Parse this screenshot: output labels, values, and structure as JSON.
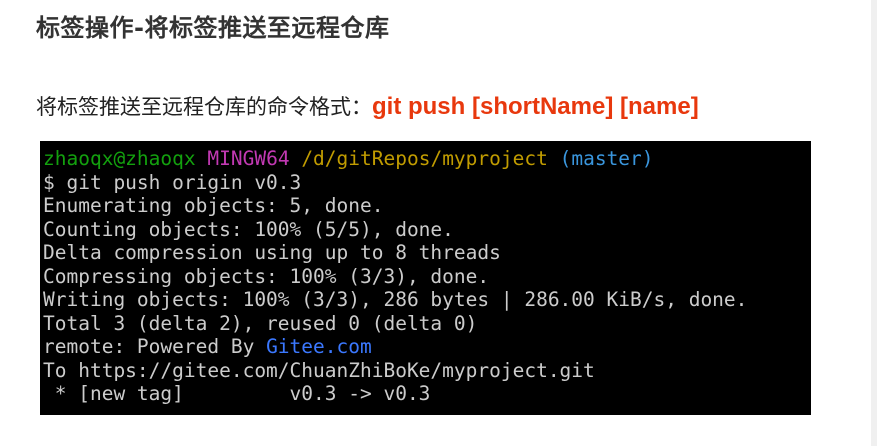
{
  "heading": {
    "title": "标签操作-将标签推送至远程仓库"
  },
  "intro": {
    "text": "将标签推送至远程仓库的命令格式：",
    "command": "git push [shortName] [name]",
    "command_color": "#e8380d"
  },
  "terminal": {
    "background": "#000000",
    "prompt": {
      "user_host": "zhaoqx@zhaoqx",
      "env": "MINGW64",
      "path": "/d/gitRepos/myproject",
      "branch": "(master)",
      "colors": {
        "user_host": "#13a10e",
        "env": "#c239b3",
        "path": "#c19c00",
        "branch": "#3a96dd"
      }
    },
    "lines": [
      "$ git push origin v0.3",
      "Enumerating objects: 5, done.",
      "Counting objects: 100% (5/5), done.",
      "Delta compression using up to 8 threads",
      "Compressing objects: 100% (3/3), done.",
      "Writing objects: 100% (3/3), 286 bytes | 286.00 KiB/s, done.",
      "Total 3 (delta 2), reused 0 (delta 0)"
    ],
    "remote_line": {
      "prefix": "remote: Powered By ",
      "link": "Gitee.com",
      "link_color": "#3b78ff"
    },
    "lines_after": [
      "To https://gitee.com/ChuanZhiBoKe/myproject.git",
      " * [new tag]         v0.3 -> v0.3"
    ],
    "text_color": "#cccccc"
  }
}
